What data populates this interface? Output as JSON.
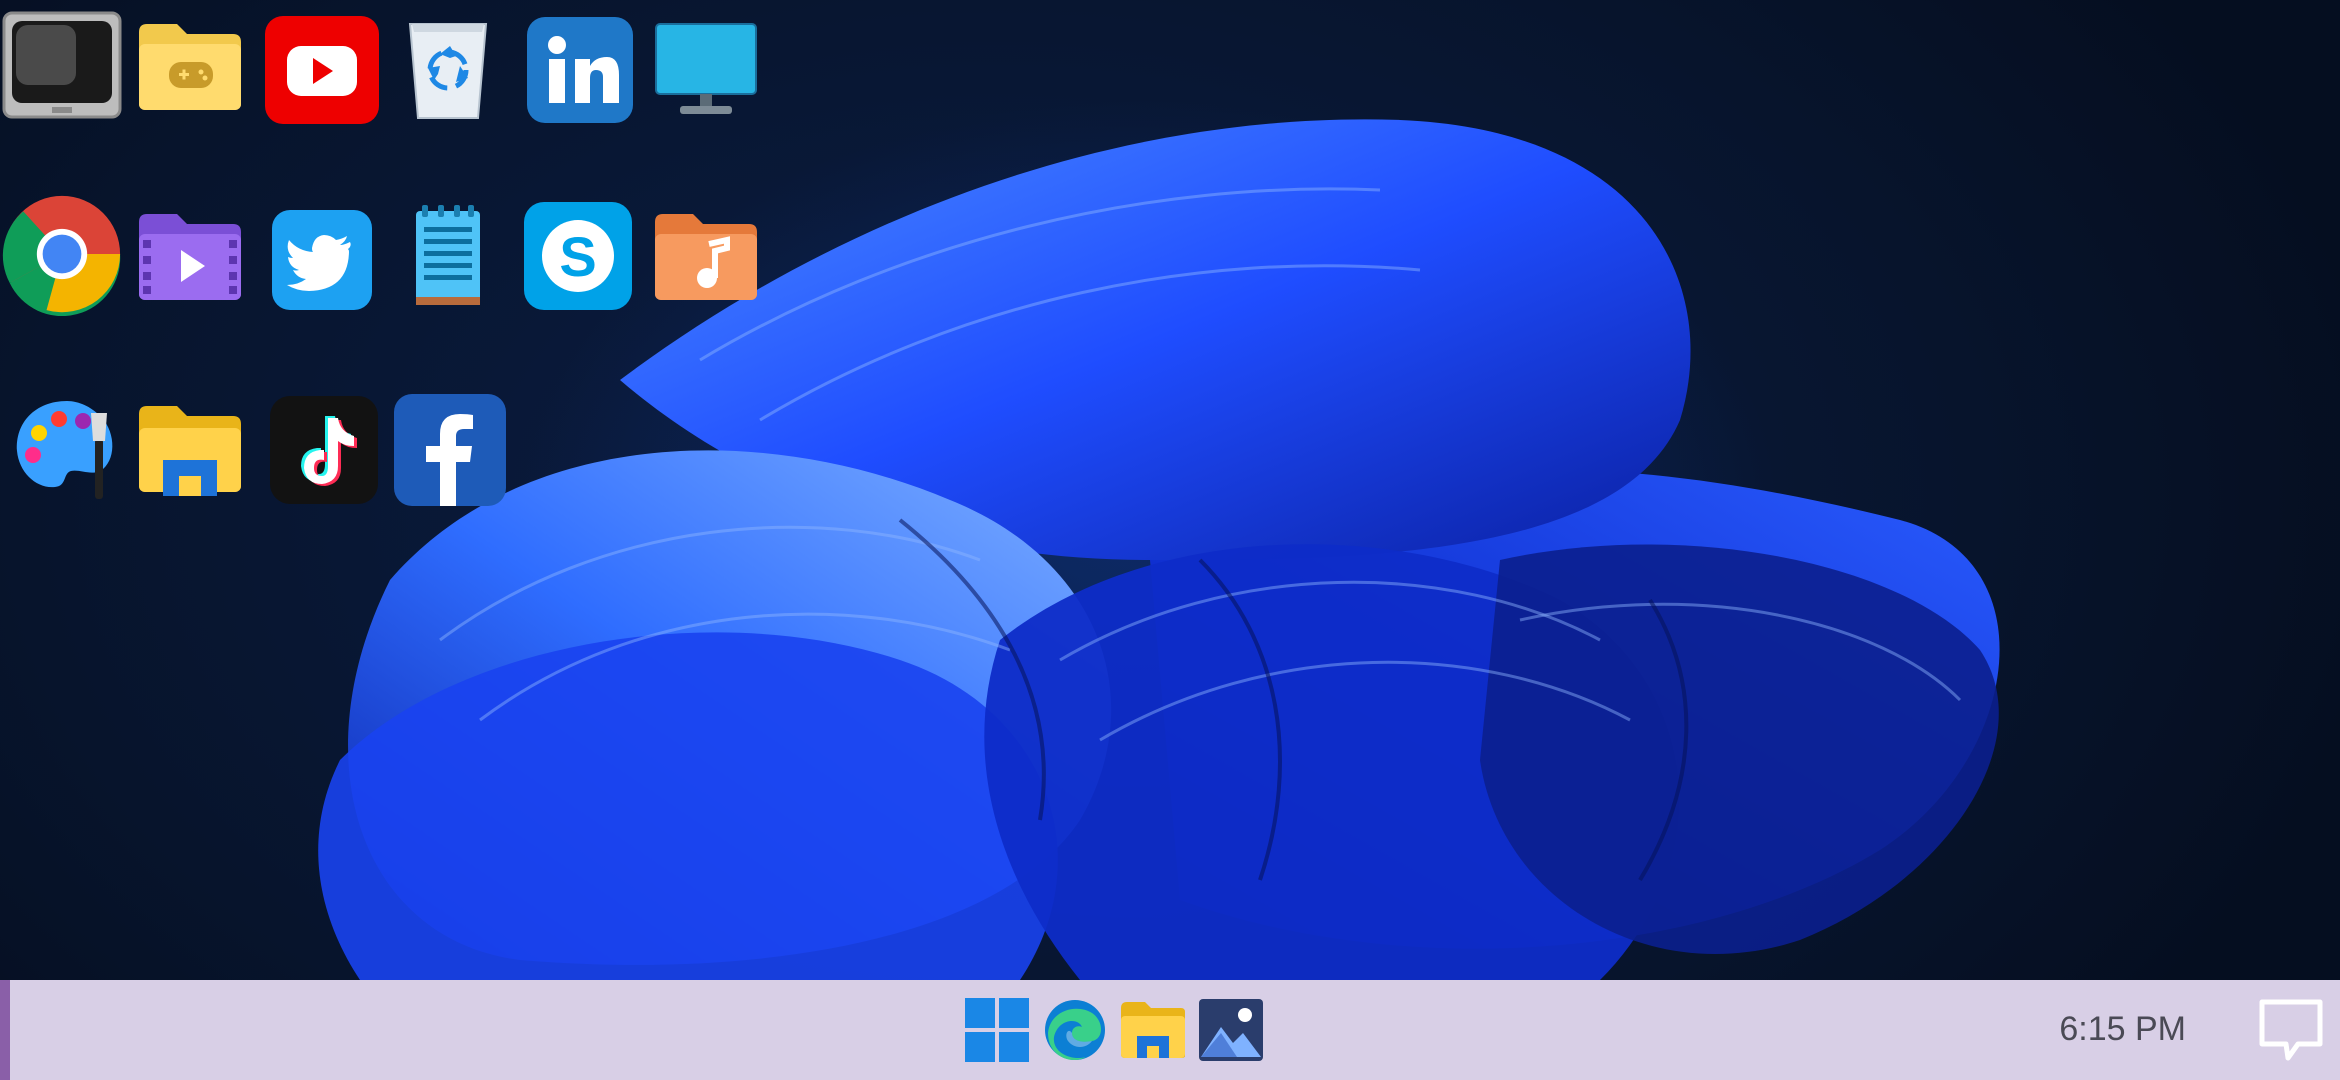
{
  "desktop": {
    "icons": [
      {
        "name": "tv-icon",
        "row": 0,
        "col": 0
      },
      {
        "name": "games-folder-icon",
        "row": 0,
        "col": 1
      },
      {
        "name": "youtube-icon",
        "row": 0,
        "col": 2
      },
      {
        "name": "recycle-bin-icon",
        "row": 0,
        "col": 3
      },
      {
        "name": "linkedin-icon",
        "row": 0,
        "col": 4
      },
      {
        "name": "monitor-icon",
        "row": 0,
        "col": 5
      },
      {
        "name": "chrome-icon",
        "row": 1,
        "col": 0
      },
      {
        "name": "videos-folder-icon",
        "row": 1,
        "col": 1
      },
      {
        "name": "twitter-icon",
        "row": 1,
        "col": 2
      },
      {
        "name": "notepad-icon",
        "row": 1,
        "col": 3
      },
      {
        "name": "skype-icon",
        "row": 1,
        "col": 4
      },
      {
        "name": "music-folder-icon",
        "row": 1,
        "col": 5
      },
      {
        "name": "paint-icon",
        "row": 2,
        "col": 0
      },
      {
        "name": "file-explorer-icon",
        "row": 2,
        "col": 1
      },
      {
        "name": "tiktok-icon",
        "row": 2,
        "col": 2
      },
      {
        "name": "facebook-icon",
        "row": 2,
        "col": 3
      }
    ]
  },
  "taskbar": {
    "apps": [
      "windows-start-icon",
      "edge-icon",
      "file-explorer-icon",
      "photos-icon"
    ],
    "clock": "6:15 PM",
    "notification": "notification-icon"
  },
  "colors": {
    "taskbar_bg": "#d8cfe6",
    "accent": "#8a5fa8",
    "wallpaper_bloom": "#1e50ff"
  }
}
